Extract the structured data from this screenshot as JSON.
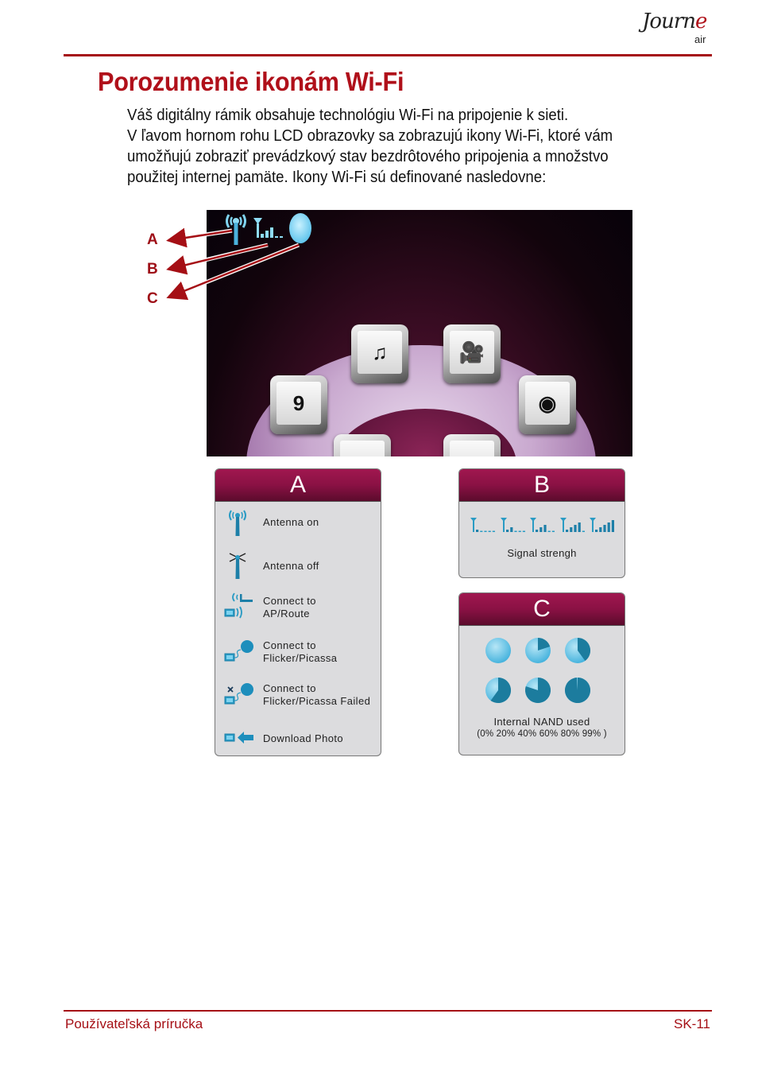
{
  "header": {
    "logo_script": "Journ",
    "logo_script_accent": "e",
    "logo_suffix": "air"
  },
  "page_title": "Porozumenie ikonám Wi-Fi",
  "intro_lines": [
    "Váš digitálny rámik obsahuje technológiu Wi-Fi na pripojenie k sieti.",
    "V ľavom hornom rohu LCD obrazovky sa zobrazujú ikony Wi-Fi, ktoré vám",
    "umožňujú zobraziť prevádzkový stav bezdrôtového pripojenia a množstvo",
    "použitej internej pamäte. Ikony Wi-Fi sú definované nasledovne:"
  ],
  "screenshot": {
    "callouts": [
      "A",
      "B",
      "C"
    ],
    "status_icons": [
      "antenna-icon",
      "signal-strength-icon",
      "nand-usage-icon"
    ],
    "menu_tiles": [
      {
        "name": "calendar-tile",
        "icon": "calendar-icon",
        "label": "9"
      },
      {
        "name": "photo-music-tile",
        "icon": "photo-music-icon",
        "label": "♫"
      },
      {
        "name": "video-tile",
        "icon": "video-camera-icon",
        "label": "🎥"
      },
      {
        "name": "speaker-tile",
        "icon": "speaker-icon",
        "label": "◉"
      }
    ]
  },
  "panel_a": {
    "title": "A",
    "items": [
      {
        "icon": "antenna-on-icon",
        "label": "Antenna on"
      },
      {
        "icon": "antenna-off-icon",
        "label": "Antenna off"
      },
      {
        "icon": "ap-router-icon",
        "label_line1": "Connect to",
        "label_line2": "AP/Route"
      },
      {
        "icon": "flickr-picasa-connect-icon",
        "label_line1": "Connect to",
        "label_line2": "Flicker/Picassa"
      },
      {
        "icon": "flickr-picasa-failed-icon",
        "label_line1": "Connect to",
        "label_line2": "Flicker/Picassa Failed"
      },
      {
        "icon": "download-photo-icon",
        "label": "Download Photo"
      }
    ]
  },
  "panel_b": {
    "title": "B",
    "signal_levels": [
      1,
      2,
      3,
      4,
      5
    ],
    "signal_max": 5,
    "label": "Signal strengh"
  },
  "panel_c": {
    "title": "C",
    "nand_levels_percent": [
      0,
      20,
      40,
      60,
      80,
      99
    ],
    "label": "Internal NAND used",
    "values_label": "(0% 20% 40% 60% 80% 99% )"
  },
  "colors": {
    "accent_red": "#a50f15",
    "panel_header": "#8a1144",
    "icon_blue": "#2a9bc4"
  },
  "footer": {
    "left": "Používateľská príručka",
    "right": "SK-11"
  }
}
